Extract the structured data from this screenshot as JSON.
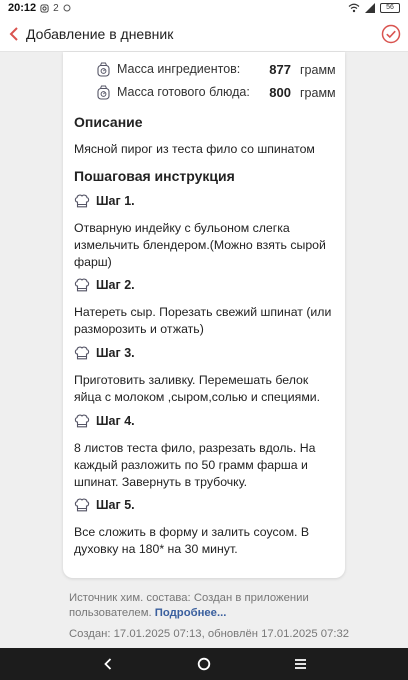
{
  "status_bar": {
    "time": "20:12",
    "notif_count": "2",
    "battery": "56"
  },
  "app_bar": {
    "title": "Добавление в дневник"
  },
  "masses": [
    {
      "label": "Масса ингредиентов:",
      "value": "877",
      "unit": "грамм"
    },
    {
      "label": "Масса готового блюда:",
      "value": "800",
      "unit": "грамм"
    }
  ],
  "description": {
    "heading": "Описание",
    "text": "Мясной пирог из теста фило со шпинатом"
  },
  "instructions": {
    "heading": "Пошаговая инструкция",
    "steps": [
      {
        "title": "Шаг 1.",
        "text": "Отварную индейку с бульоном слегка измельчить блендером.(Можно взять сырой фарш)"
      },
      {
        "title": "Шаг 2.",
        "text": "Натереть сыр. Порезать свежий шпинат (или разморозить и отжать)"
      },
      {
        "title": "Шаг 3.",
        "text": "Приготовить заливку. Перемешать белок яйца с молоком ,сыром,солью и специями."
      },
      {
        "title": "Шаг 4.",
        "text": "8 листов теста фило, разрезать вдоль. На каждый разложить по 50 грамм фарша и шпинат. Завернуть в трубочку."
      },
      {
        "title": "Шаг 5.",
        "text": "Все сложить в форму и залить соусом. В духовку на 180* на 30 минут."
      }
    ]
  },
  "source": {
    "text": "Источник хим. состава: Создан в приложении пользователем.",
    "more": "Подробнее..."
  },
  "created": "Создан: 17.01.2025 07:13, обновлён 17.01.2025 07:32",
  "colors": {
    "accent": "#d9534f",
    "link": "#3a5f9e",
    "nav_bg": "#1c1c1c"
  }
}
